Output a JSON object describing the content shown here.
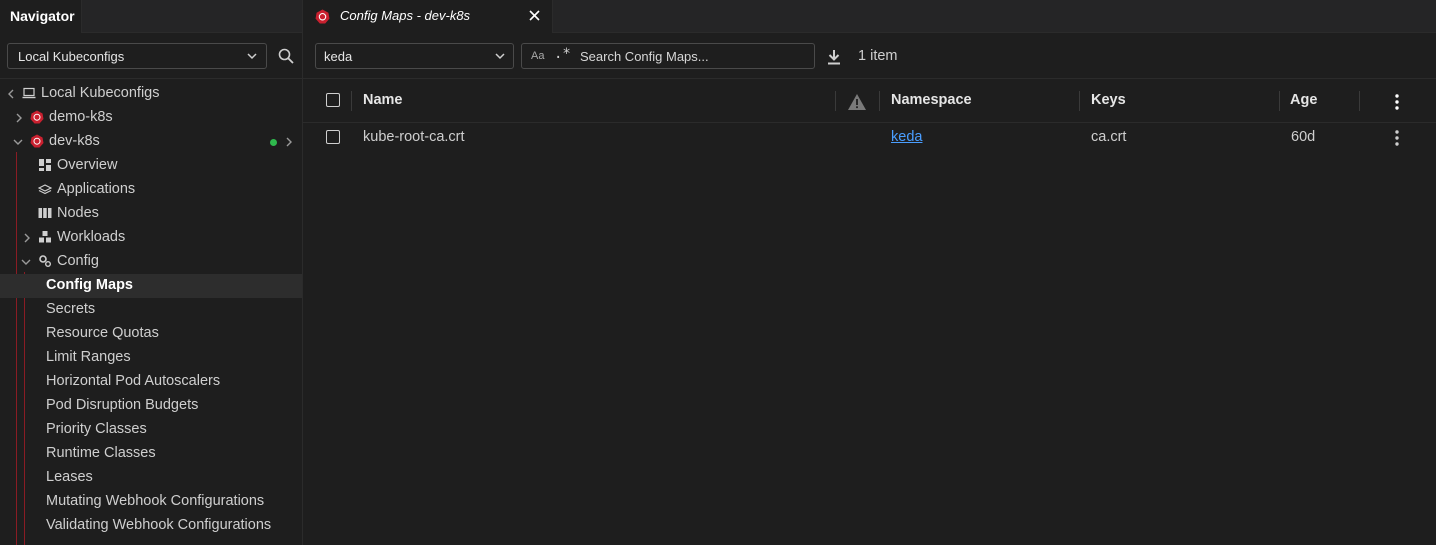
{
  "sidebar": {
    "tab_label": "Navigator",
    "context_select": "Local Kubeconfigs",
    "tree": {
      "root": "Local Kubeconfigs",
      "clusters": [
        {
          "label": "demo-k8s"
        },
        {
          "label": "dev-k8s"
        }
      ],
      "items": [
        {
          "label": "Overview"
        },
        {
          "label": "Applications"
        },
        {
          "label": "Nodes"
        },
        {
          "label": "Workloads"
        },
        {
          "label": "Config"
        }
      ],
      "config_items": [
        {
          "label": "Config Maps"
        },
        {
          "label": "Secrets"
        },
        {
          "label": "Resource Quotas"
        },
        {
          "label": "Limit Ranges"
        },
        {
          "label": "Horizontal Pod Autoscalers"
        },
        {
          "label": "Pod Disruption Budgets"
        },
        {
          "label": "Priority Classes"
        },
        {
          "label": "Runtime Classes"
        },
        {
          "label": "Leases"
        },
        {
          "label": "Mutating Webhook Configurations"
        },
        {
          "label": "Validating Webhook Configurations"
        }
      ]
    }
  },
  "main": {
    "tab_title": "Config Maps - dev-k8s",
    "namespace_select": "keda",
    "search": {
      "case_label": "Aa",
      "regex_label": ".*",
      "placeholder": "Search Config Maps..."
    },
    "item_count": "1 item",
    "table": {
      "headers": {
        "name": "Name",
        "namespace": "Namespace",
        "keys": "Keys",
        "age": "Age"
      },
      "rows": [
        {
          "name": "kube-root-ca.crt",
          "namespace": "keda",
          "keys": "ca.crt",
          "age": "60d"
        }
      ]
    }
  },
  "colors": {
    "accent_red": "#c9202f",
    "status_green": "#2fb94d",
    "link_blue": "#4a9eff"
  }
}
